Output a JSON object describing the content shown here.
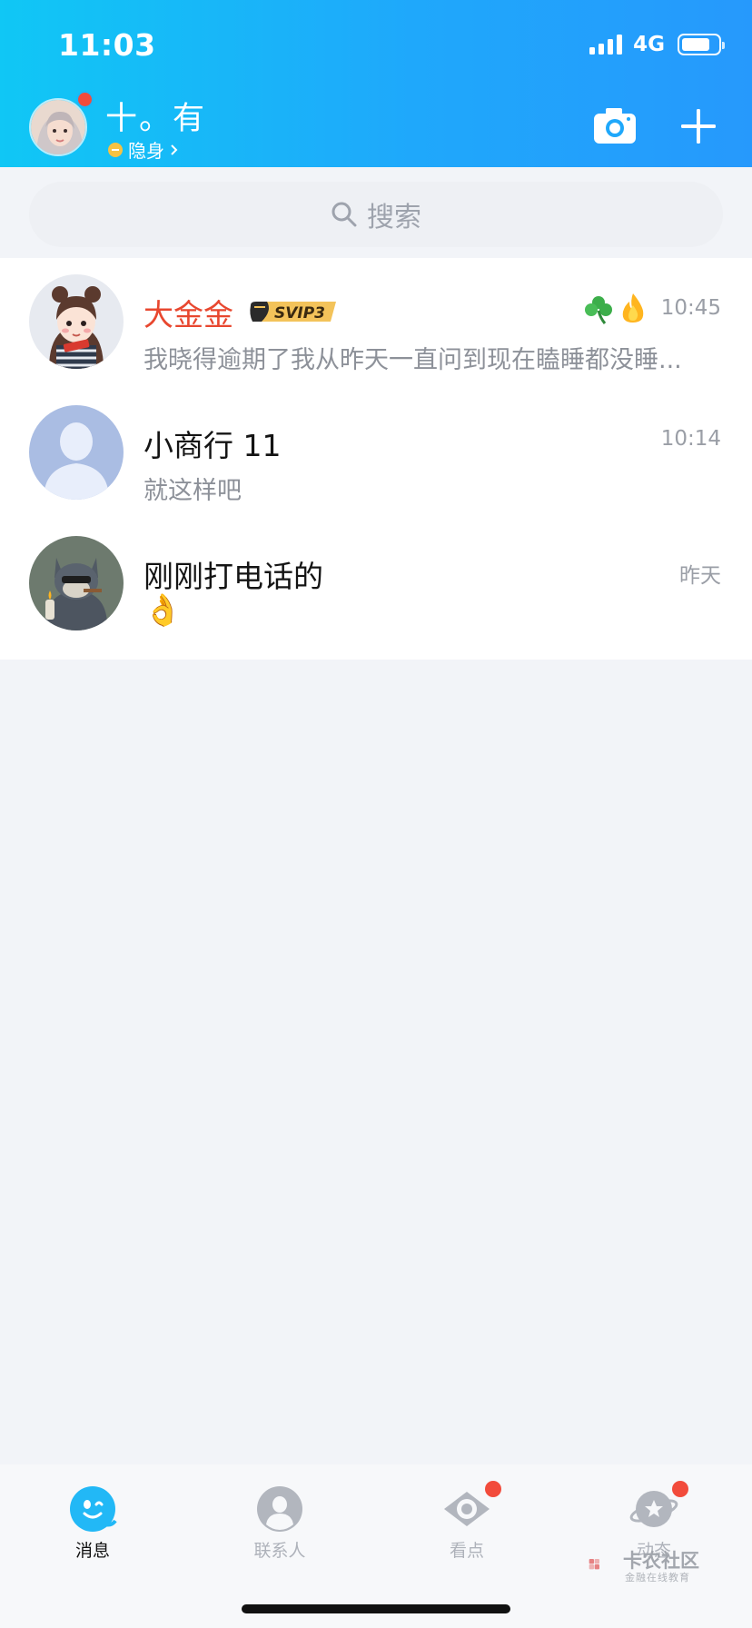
{
  "status_bar": {
    "time": "11:03",
    "network": "4G",
    "battery_level": 0.8
  },
  "header": {
    "profile_name": "十。有",
    "profile_status": "隐身",
    "accent": "#1fa8fb"
  },
  "search": {
    "placeholder": "搜索"
  },
  "conversations": [
    {
      "name": "大金金",
      "badge": "SVIP3",
      "preview": "我晓得逾期了我从昨天一直问到现在瞌睡都没睡...",
      "time": "10:45",
      "name_color": "#e8472f"
    },
    {
      "name": "小商行 11",
      "preview": "就这样吧",
      "time": "10:14"
    },
    {
      "name": "刚刚打电话的",
      "preview": "👌",
      "time": "昨天"
    }
  ],
  "tabs": [
    {
      "label": "消息",
      "icon": "penguin-icon",
      "active": true
    },
    {
      "label": "联系人",
      "icon": "contacts-icon",
      "active": false
    },
    {
      "label": "看点",
      "icon": "eye-icon",
      "active": false,
      "badge": true
    },
    {
      "label": "动态",
      "icon": "planet-icon",
      "active": false,
      "badge": true
    }
  ],
  "watermark": {
    "title": "卡农社区",
    "subtitle": "金融在线教育"
  }
}
